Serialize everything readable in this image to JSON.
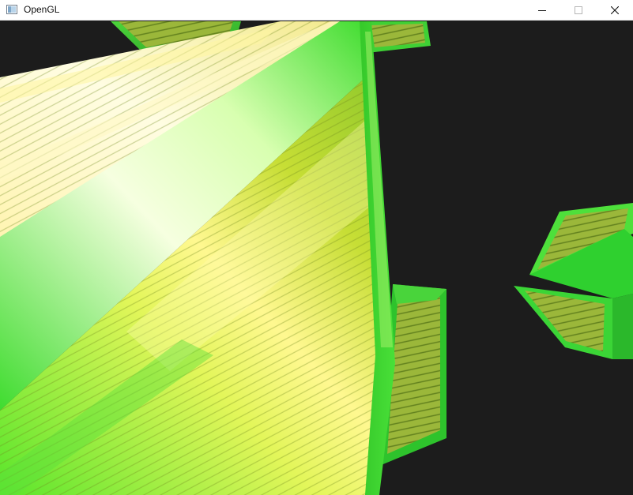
{
  "window": {
    "title": "OpenGL",
    "controls": {
      "minimize_icon": "minimize-icon",
      "maximize_icon": "maximize-icon",
      "close_icon": "close-icon"
    }
  },
  "scene": {
    "clear_color": "#1c1c1c",
    "crate_green": "#3fe03f",
    "crate_yellow": "#f2f27a",
    "crate_wood": "#9dbb3a"
  }
}
